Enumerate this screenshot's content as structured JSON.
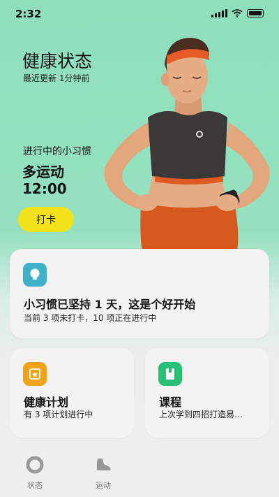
{
  "status_bar": {
    "time": "2:32"
  },
  "header": {
    "title": "健康状态",
    "subtitle": "最近更新 1分钟前"
  },
  "habit": {
    "label": "进行中的小习惯",
    "name": "多运动",
    "time": "12:00",
    "button": "打卡"
  },
  "cards": {
    "main": {
      "title": "小习惯已坚持 1 天，这是个好开始",
      "detail": "当前 3 项未打卡，10 项正在进行中",
      "icon": "lightbulb-icon",
      "icon_color": "#3fb2c9"
    },
    "plan": {
      "title": "健康计划",
      "detail": "有 3 项计划进行中",
      "icon": "calendar-icon",
      "icon_color": "#f0a219"
    },
    "course": {
      "title": "课程",
      "detail": "上次学到四招打造易…",
      "icon": "book-icon",
      "icon_color": "#27c076"
    }
  },
  "tabs": [
    {
      "label": "状态",
      "icon": "status-ring-icon"
    },
    {
      "label": "运动",
      "icon": "shoe-icon"
    }
  ],
  "colors": {
    "accent_yellow": "#f2e21a",
    "header_green": "#8fdfbd"
  }
}
